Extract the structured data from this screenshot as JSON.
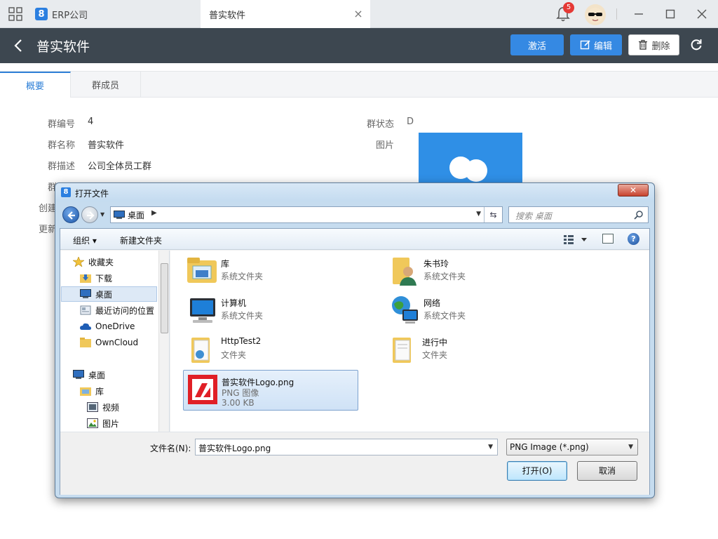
{
  "window": {
    "app_tab_label": "ERP公司",
    "active_tab_label": "普实软件",
    "notification_count": "5"
  },
  "header": {
    "title": "普实软件",
    "activate_label": "激活",
    "edit_label": "编辑",
    "delete_label": "删除"
  },
  "tabs": [
    {
      "label": "概要",
      "active": true
    },
    {
      "label": "群成员",
      "active": false
    }
  ],
  "details": {
    "group_no_label": "群编号",
    "group_no_value": "4",
    "group_name_label": "群名称",
    "group_name_value": "普实软件",
    "group_desc_label": "群描述",
    "group_desc_value": "公司全体员工群",
    "status_label": "群状态",
    "status_value": "D",
    "image_label": "图片",
    "partial_label_1": "群",
    "partial_label_2": "创建",
    "partial_label_3": "更新"
  },
  "dialog": {
    "title": "打开文件",
    "address": "桌面",
    "search_placeholder": "搜索 桌面",
    "toolbar": {
      "organize_label": "组织 ▾",
      "new_folder_label": "新建文件夹"
    },
    "tree": [
      {
        "label": "收藏夹",
        "icon": "star-icon"
      },
      {
        "label": "下载",
        "icon": "download-folder-icon"
      },
      {
        "label": "桌面",
        "icon": "desktop-icon",
        "selected": true
      },
      {
        "label": "最近访问的位置",
        "icon": "recent-places-icon"
      },
      {
        "label": "OneDrive",
        "icon": "cloud-icon"
      },
      {
        "label": "OwnCloud",
        "icon": "folder-icon"
      },
      {
        "label": "桌面",
        "icon": "desktop-icon"
      },
      {
        "label": "库",
        "icon": "library-icon"
      },
      {
        "label": "视频",
        "icon": "video-icon"
      },
      {
        "label": "图片",
        "icon": "pictures-icon"
      }
    ],
    "files": [
      {
        "name": "库",
        "type": "系统文件夹",
        "icon": "library-icon"
      },
      {
        "name": "朱书玲",
        "type": "系统文件夹",
        "icon": "user-folder-icon"
      },
      {
        "name": "计算机",
        "type": "系统文件夹",
        "icon": "computer-icon"
      },
      {
        "name": "网络",
        "type": "系统文件夹",
        "icon": "network-icon"
      },
      {
        "name": "HttpTest2",
        "type": "文件夹",
        "icon": "folder-icon"
      },
      {
        "name": "进行中",
        "type": "文件夹",
        "icon": "folder-icon"
      },
      {
        "name": "普实软件Logo.png",
        "type": "PNG 图像",
        "size": "3.00 KB",
        "icon": "png-image-icon",
        "selected": true
      }
    ],
    "filename_label": "文件名(N):",
    "filename_value": "普实软件Logo.png",
    "filetype_value": "PNG Image (*.png)",
    "open_label": "打开(O)",
    "cancel_label": "取消"
  },
  "colors": {
    "accent": "#3589e3",
    "header_bg": "#3d4750",
    "badge": "#e53935"
  }
}
